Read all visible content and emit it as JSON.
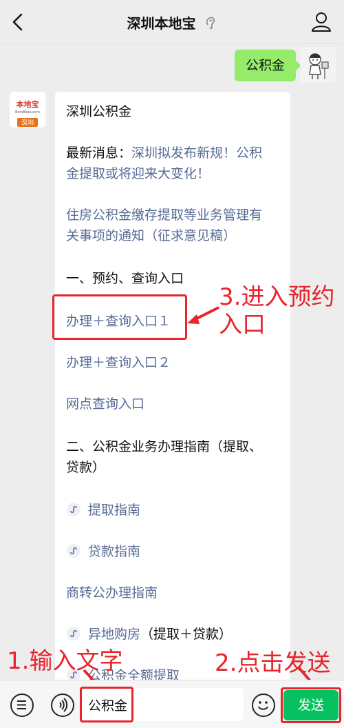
{
  "header": {
    "title": "深圳本地宝"
  },
  "user_message": "公积金",
  "bot": {
    "heading": "深圳公积金",
    "news_label": "最新消息：",
    "news_line1": "深圳拟发布新规！公积",
    "news_line2": "金提取或将迎来大变化！",
    "notice_line1": "住房公积金缴存提取等业务管理有",
    "notice_line2": "关事项的通知（征求意见稿）",
    "section1": "一、预约、查询入口",
    "entry1": "办理＋查询入口１",
    "entry2": "办理＋查询入口２",
    "entry3": "网点查询入口",
    "section2_line1": "二、公积金业务办理指南（提取、",
    "section2_line2": "贷款）",
    "guide_withdraw": "提取指南",
    "guide_loan": "贷款指南",
    "guide_transfer": "商转公办理指南",
    "guide_offsite": "异地购房",
    "guide_offsite_suffix": "（提取＋贷款）",
    "guide_partial": "公积金全额提取"
  },
  "avatar_logo": {
    "top": "本地宝",
    "mid": "Bendibao.com",
    "tag": "深圳"
  },
  "annotations": {
    "step3_line1": "3.进入预约",
    "step3_line2": "入口",
    "step1": "1.输入文字",
    "step2": "2.点击发送"
  },
  "input": {
    "value": "公积金",
    "send_label": "发送"
  },
  "colors": {
    "accent_green": "#07c160",
    "bubble_green": "#95ec69",
    "link_blue": "#576b95",
    "annotation_red": "#e8242c"
  }
}
